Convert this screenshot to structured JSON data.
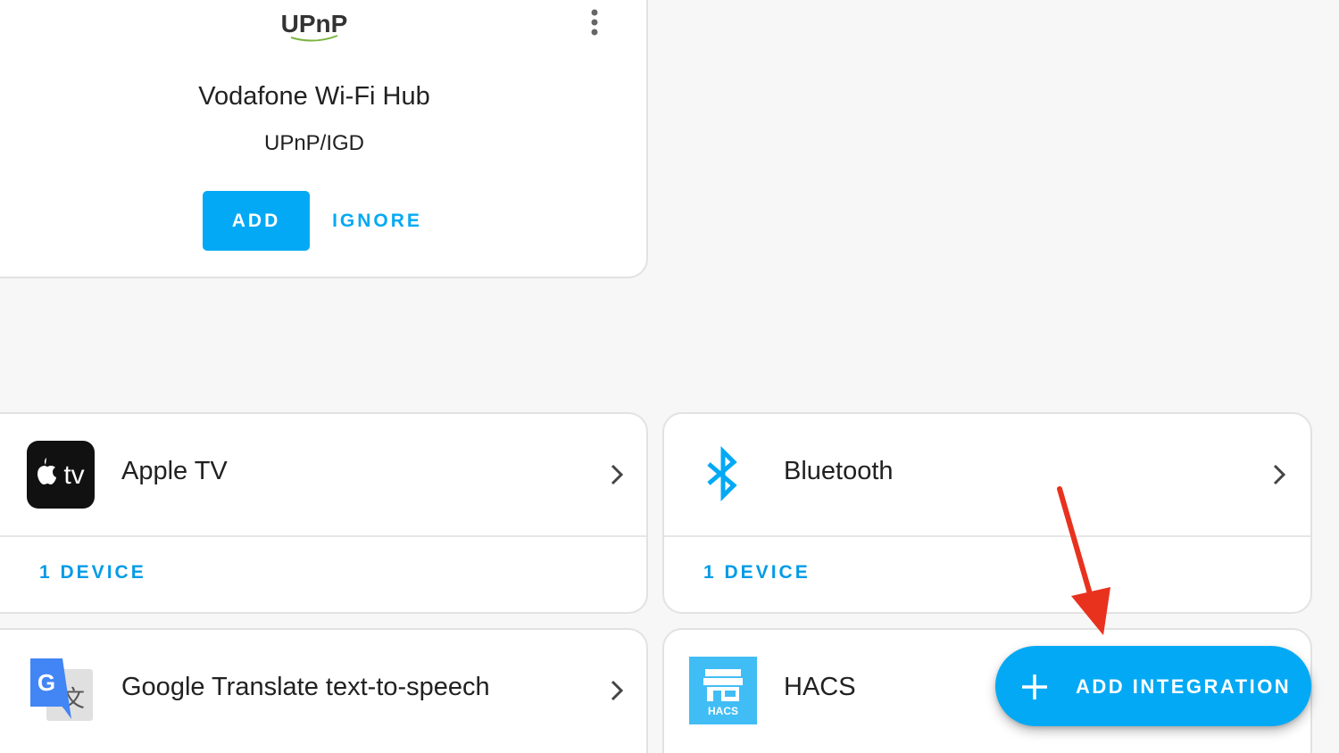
{
  "discovered": {
    "logo_text": "UPnP",
    "title": "Vodafone Wi-Fi Hub",
    "subtitle": "UPnP/IGD",
    "add_label": "ADD",
    "ignore_label": "IGNORE",
    "menu_icon": "more-vertical-icon"
  },
  "integrations": [
    {
      "name": "Apple TV",
      "devices": "1 DEVICE",
      "icon": "apple-tv-icon",
      "icon_text": "tv"
    },
    {
      "name": "Bluetooth",
      "devices": "1 DEVICE",
      "icon": "bluetooth-icon"
    },
    {
      "name": "Google Translate text-to-speech",
      "icon": "google-translate-icon",
      "icon_text": "G"
    },
    {
      "name": "HACS",
      "icon": "hacs-icon",
      "icon_text": "HACS"
    }
  ],
  "fab": {
    "label": "ADD INTEGRATION",
    "icon": "plus-icon"
  },
  "annotation": {
    "icon": "red-arrow-icon",
    "color": "#e8321e"
  },
  "colors": {
    "accent": "#03a9f4",
    "link": "#039be5",
    "background": "#f7f7f7",
    "card": "#ffffff"
  }
}
